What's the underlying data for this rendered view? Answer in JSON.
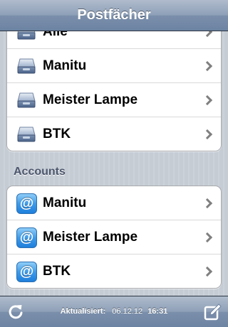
{
  "navbar": {
    "title": "Postfächer"
  },
  "mailboxes": {
    "items": [
      {
        "label": "Alle",
        "icon": "inbox-tray-icon"
      },
      {
        "label": "Manitu",
        "icon": "inbox-tray-icon"
      },
      {
        "label": "Meister Lampe",
        "icon": "inbox-tray-icon"
      },
      {
        "label": "BTK",
        "icon": "inbox-tray-icon"
      }
    ]
  },
  "accounts": {
    "header": "Accounts",
    "items": [
      {
        "label": "Manitu",
        "icon": "at-sign-icon"
      },
      {
        "label": "Meister Lampe",
        "icon": "at-sign-icon"
      },
      {
        "label": "BTK",
        "icon": "at-sign-icon"
      }
    ],
    "icon_glyph": "@"
  },
  "toolbar": {
    "updated_label": "Aktualisiert:",
    "updated_date": "06.12.12",
    "updated_time": "16:31",
    "refresh_icon": "refresh-icon",
    "compose_icon": "compose-icon"
  },
  "colors": {
    "bar_blue": "#6c83a2",
    "section_header": "#4c566c",
    "account_icon_blue": "#1e7fdc"
  }
}
